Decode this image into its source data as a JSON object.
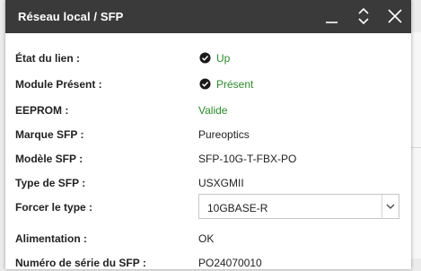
{
  "window": {
    "title": "Réseau local / SFP"
  },
  "rows": [
    {
      "label": "État du lien :",
      "value": "Up"
    },
    {
      "label": "Module Présent :",
      "value": "Présent"
    },
    {
      "label": "EEPROM :",
      "value": "Valide"
    },
    {
      "label": "Marque SFP :",
      "value": "Pureoptics"
    },
    {
      "label": "Modèle SFP :",
      "value": "SFP-10G-T-FBX-PO"
    },
    {
      "label": "Type de SFP :",
      "value": "USXGMII"
    },
    {
      "label": "Forcer le type :",
      "value": "10GBASE-R"
    },
    {
      "label": "Alimentation :",
      "value": "OK"
    },
    {
      "label": "Numéro de série du SFP :",
      "value": "PO24070010"
    }
  ],
  "colors": {
    "titlebar": "#3a3a3a",
    "status_ok": "#2a8a2a"
  },
  "icons": {
    "status_ok": "check-circle-icon",
    "minimize": "minimize-icon",
    "maximize": "maximize-icon",
    "close": "close-icon",
    "dropdown": "chevron-down-icon"
  }
}
